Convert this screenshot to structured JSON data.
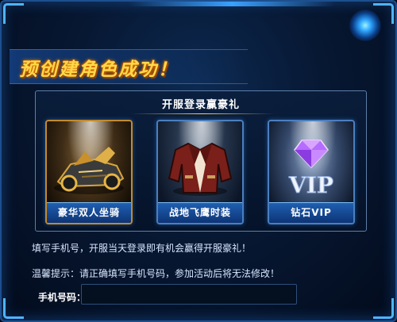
{
  "title": "预创建角色成功！",
  "rewards": {
    "heading": "开服登录赢豪礼",
    "items": [
      {
        "label": "豪华双人坐骑",
        "icon": "mount-vehicle-icon"
      },
      {
        "label": "战地飞鹰时装",
        "icon": "jacket-outfit-icon"
      },
      {
        "label": "钻石VIP",
        "icon": "diamond-vip-icon",
        "badge_text": "VIP"
      }
    ]
  },
  "info": {
    "line1": "填写手机号，开服当天登录即有机会赢得开服豪礼！",
    "line2": "温馨提示：请正确填写手机号码，参加活动后将无法修改！"
  },
  "phone": {
    "label": "手机号码：",
    "value": "",
    "placeholder": ""
  },
  "colors": {
    "accent": "#ffd84a",
    "frame": "#1d4f8f",
    "card_label_bg": "#1f5fb1"
  }
}
